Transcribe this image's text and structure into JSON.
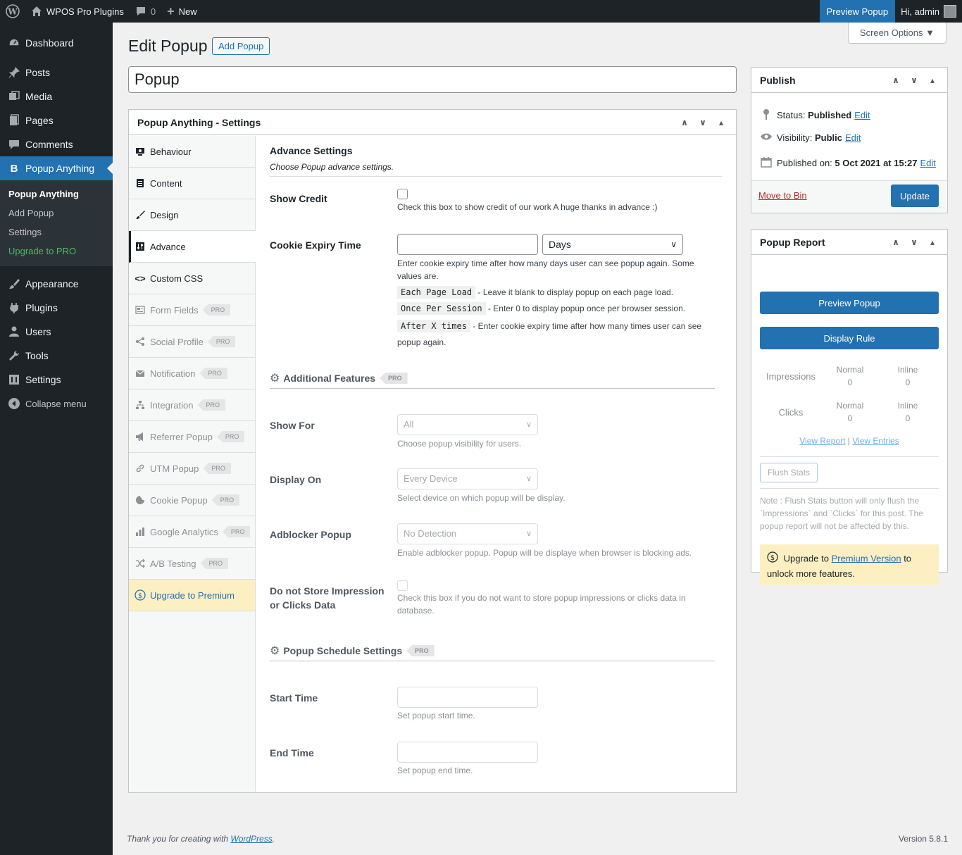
{
  "adminbar": {
    "site_name": "WPOS Pro Plugins",
    "comments_count": "0",
    "new_label": "New",
    "preview_label": "Preview Popup",
    "greeting": "Hi, admin"
  },
  "menu": {
    "items": [
      {
        "label": "Dashboard",
        "icon": "dashboard-icon"
      },
      {
        "label": "Posts",
        "icon": "pin-icon"
      },
      {
        "label": "Media",
        "icon": "media-icon"
      },
      {
        "label": "Pages",
        "icon": "pages-icon"
      },
      {
        "label": "Comments",
        "icon": "comments-icon"
      },
      {
        "label": "Popup Anything",
        "icon": "b-icon"
      },
      {
        "label": "Appearance",
        "icon": "brush-icon"
      },
      {
        "label": "Plugins",
        "icon": "plug-icon"
      },
      {
        "label": "Users",
        "icon": "user-icon"
      },
      {
        "label": "Tools",
        "icon": "wrench-icon"
      },
      {
        "label": "Settings",
        "icon": "settings-icon"
      },
      {
        "label": "Collapse menu",
        "icon": "collapse-icon"
      }
    ],
    "submenu": [
      "Popup Anything",
      "Add Popup",
      "Settings",
      "Upgrade to PRO"
    ]
  },
  "screen_options": "Screen Options ▼",
  "page": {
    "title": "Edit Popup",
    "add_button": "Add Popup",
    "post_title": "Popup"
  },
  "settings": {
    "header": "Popup Anything - Settings",
    "tabs": [
      {
        "label": "Behaviour",
        "icon": "monitor-icon",
        "pro": false
      },
      {
        "label": "Content",
        "icon": "document-icon",
        "pro": false
      },
      {
        "label": "Design",
        "icon": "brush-icon",
        "pro": false
      },
      {
        "label": "Advance",
        "icon": "sliders-icon",
        "pro": false
      },
      {
        "label": "Custom CSS",
        "icon": "code-icon",
        "pro": false
      },
      {
        "label": "Form Fields",
        "icon": "form-icon",
        "pro": true
      },
      {
        "label": "Social Profile",
        "icon": "share-icon",
        "pro": true
      },
      {
        "label": "Notification",
        "icon": "mail-icon",
        "pro": true
      },
      {
        "label": "Integration",
        "icon": "network-icon",
        "pro": true
      },
      {
        "label": "Referrer Popup",
        "icon": "megaphone-icon",
        "pro": true
      },
      {
        "label": "UTM Popup",
        "icon": "link-icon",
        "pro": true
      },
      {
        "label": "Cookie Popup",
        "icon": "cookie-icon",
        "pro": true
      },
      {
        "label": "Google Analytics",
        "icon": "chart-icon",
        "pro": true
      },
      {
        "label": "A/B Testing",
        "icon": "shuffle-icon",
        "pro": true
      },
      {
        "label": "Upgrade to Premium",
        "icon": "dollar-icon",
        "pro": false
      }
    ],
    "pro_label": "PRO",
    "advance": {
      "title": "Advance Settings",
      "subtitle": "Choose Popup advance settings.",
      "show_credit": {
        "label": "Show Credit",
        "desc": "Check this box to show credit of our work A huge thanks in advance :)"
      },
      "cookie": {
        "label": "Cookie Expiry Time",
        "unit": "Days",
        "desc": "Enter cookie expiry time after how many days user can see popup again. Some values are.",
        "opt1_code": "Each Page Load",
        "opt1_desc": "- Leave it blank to display popup on each page load.",
        "opt2_code": "Once Per Session",
        "opt2_desc": "- Enter 0 to display popup once per browser session.",
        "opt3_code": "After X times",
        "opt3_desc": "- Enter cookie expiry time after how many times user can see popup again."
      },
      "additional_title": "Additional Features",
      "show_for": {
        "label": "Show For",
        "value": "All",
        "desc": "Choose popup visibility for users."
      },
      "display_on": {
        "label": "Display On",
        "value": "Every Device",
        "desc": "Select device on which popup will be display."
      },
      "adblocker": {
        "label": "Adblocker Popup",
        "value": "No Detection",
        "desc": "Enable adblocker popup. Popup will be displaye when browser is blocking ads."
      },
      "no_store": {
        "label_line1": "Do not Store Impression",
        "label_line2": "or Clicks Data",
        "desc": "Check this box if you do not want to store popup impressions or clicks data in database."
      },
      "schedule_title": "Popup Schedule Settings",
      "start": {
        "label": "Start Time",
        "desc": "Set popup start time."
      },
      "end": {
        "label": "End Time",
        "desc": "Set popup end time."
      }
    }
  },
  "publish": {
    "title": "Publish",
    "status_label": "Status:",
    "status_value": "Published",
    "visibility_label": "Visibility:",
    "visibility_value": "Public",
    "published_label": "Published on:",
    "published_value": "5 Oct 2021 at 15:27",
    "edit": "Edit",
    "move_to_bin": "Move to Bin",
    "update": "Update"
  },
  "report": {
    "title": "Popup Report",
    "preview_btn": "Preview Popup",
    "display_rule_btn": "Display Rule",
    "impressions": "Impressions",
    "clicks": "Clicks",
    "normal": "Normal",
    "inline": "Inline",
    "imp_normal": "0",
    "imp_inline": "0",
    "clk_normal": "0",
    "clk_inline": "0",
    "view_report": "View Report",
    "sep": "|",
    "view_entries": "View Entries",
    "flush": "Flush Stats",
    "note": "Note : Flush Stats button will only flush the `Impressions` and `Clicks` for this post. The popup report will not be affected by this.",
    "upgrade_pre": "Upgrade to",
    "upgrade_link": "Premium Version",
    "upgrade_post": "to unlock more features."
  },
  "footer": {
    "thanks": "Thank you for creating with",
    "wp_link": "WordPress",
    "dot": ".",
    "version": "Version 5.8.1"
  }
}
